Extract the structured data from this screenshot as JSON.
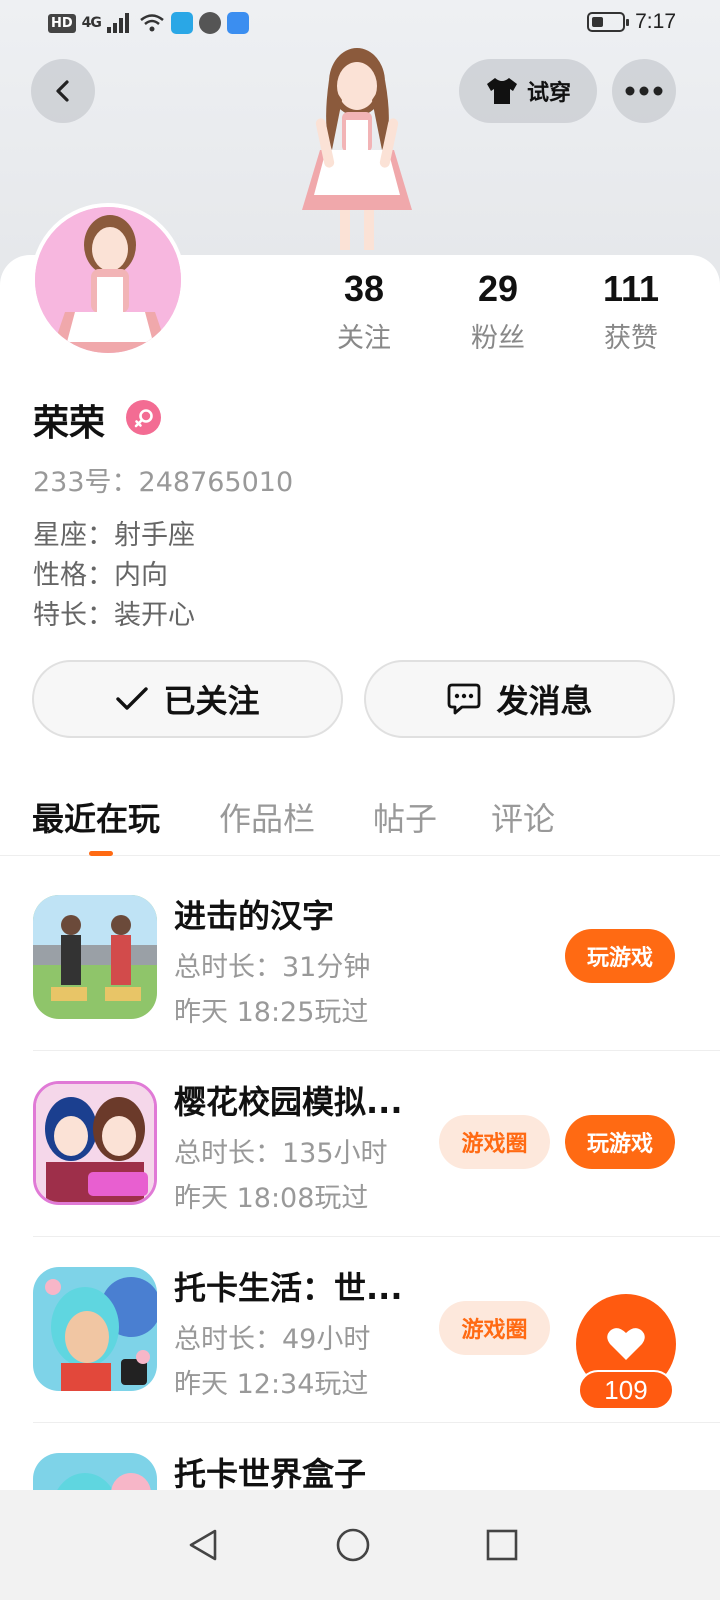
{
  "status_bar": {
    "hd": "HD",
    "signal": "4G",
    "time": "7:17",
    "battery_level": 0.35
  },
  "header": {
    "tryon_label": "试穿"
  },
  "profile": {
    "stats": [
      {
        "value": "38",
        "label": "关注"
      },
      {
        "value": "29",
        "label": "粉丝"
      },
      {
        "value": "111",
        "label": "获赞"
      }
    ],
    "name": "荣荣",
    "gender_icon": "female-icon",
    "uid": "233号：248765010",
    "info": [
      "星座：射手座",
      "性格：内向",
      "特长：装开心"
    ]
  },
  "actions": {
    "follow_label": "已关注",
    "message_label": "发消息"
  },
  "tabs": [
    {
      "label": "最近在玩",
      "active": true
    },
    {
      "label": "作品栏",
      "active": false
    },
    {
      "label": "帖子",
      "active": false
    },
    {
      "label": "评论",
      "active": false
    }
  ],
  "games": [
    {
      "title": "进击的汉字",
      "duration": "总时长：31分钟",
      "last_played": "昨天 18:25玩过",
      "circle_label": "",
      "play_label": "玩游戏"
    },
    {
      "title": "樱花校园模拟...",
      "duration": "总时长：135小时",
      "last_played": "昨天 18:08玩过",
      "circle_label": "游戏圈",
      "play_label": "玩游戏"
    },
    {
      "title": "托卡生活：世...",
      "duration": "总时长：49小时",
      "last_played": "昨天 12:34玩过",
      "circle_label": "游戏圈",
      "play_label": ""
    },
    {
      "title": "托卡世界盒子",
      "duration": "",
      "last_played": "",
      "circle_label": "",
      "play_label": ""
    }
  ],
  "like_fab": {
    "count": "109"
  },
  "colors": {
    "accent": "#ff6a13",
    "accent_light": "#fde8dc",
    "gender_pink": "#f36c93"
  }
}
